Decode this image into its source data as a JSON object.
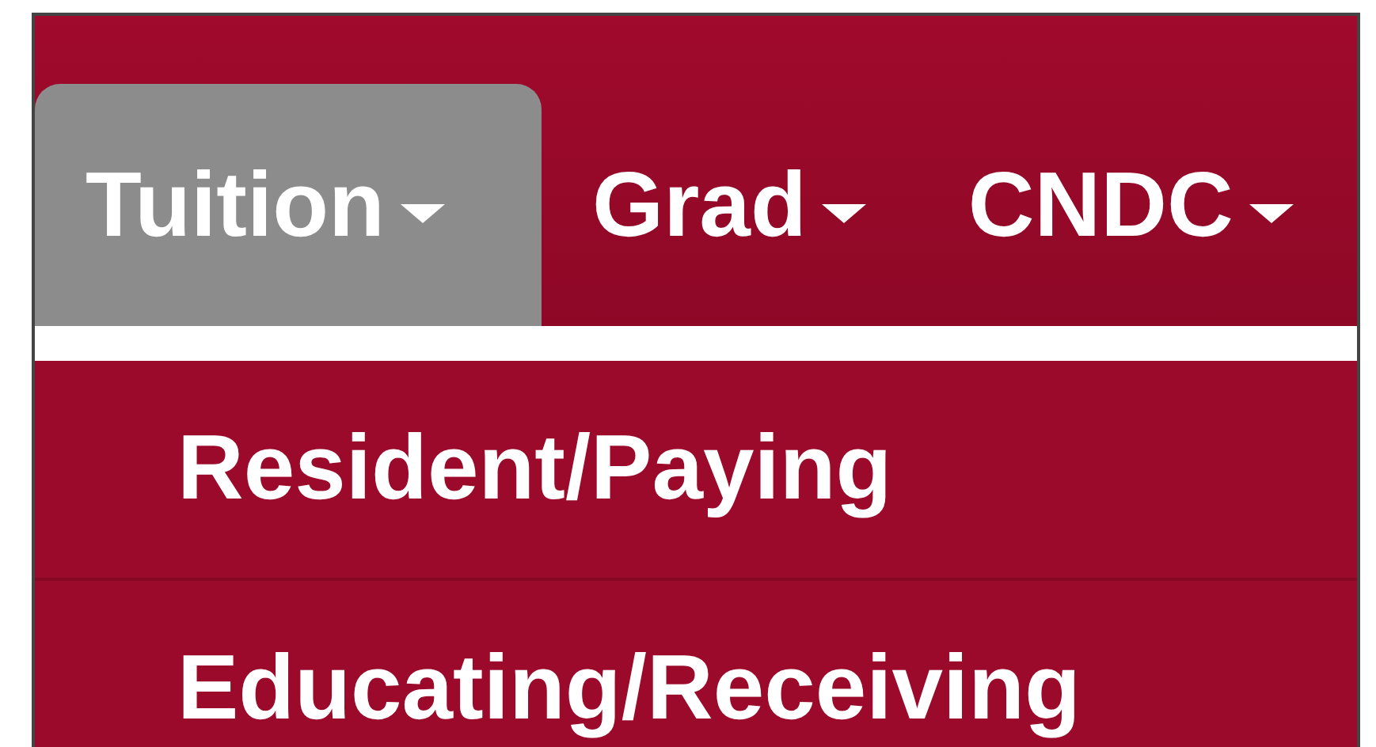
{
  "menu": [
    {
      "label": "Tuition",
      "selected": true
    },
    {
      "label": "Grad",
      "selected": false
    },
    {
      "label": "CNDC",
      "selected": false
    }
  ],
  "dropdown": {
    "items": [
      {
        "label": "Resident/Paying"
      },
      {
        "label": "Educating/Receiving"
      }
    ]
  }
}
